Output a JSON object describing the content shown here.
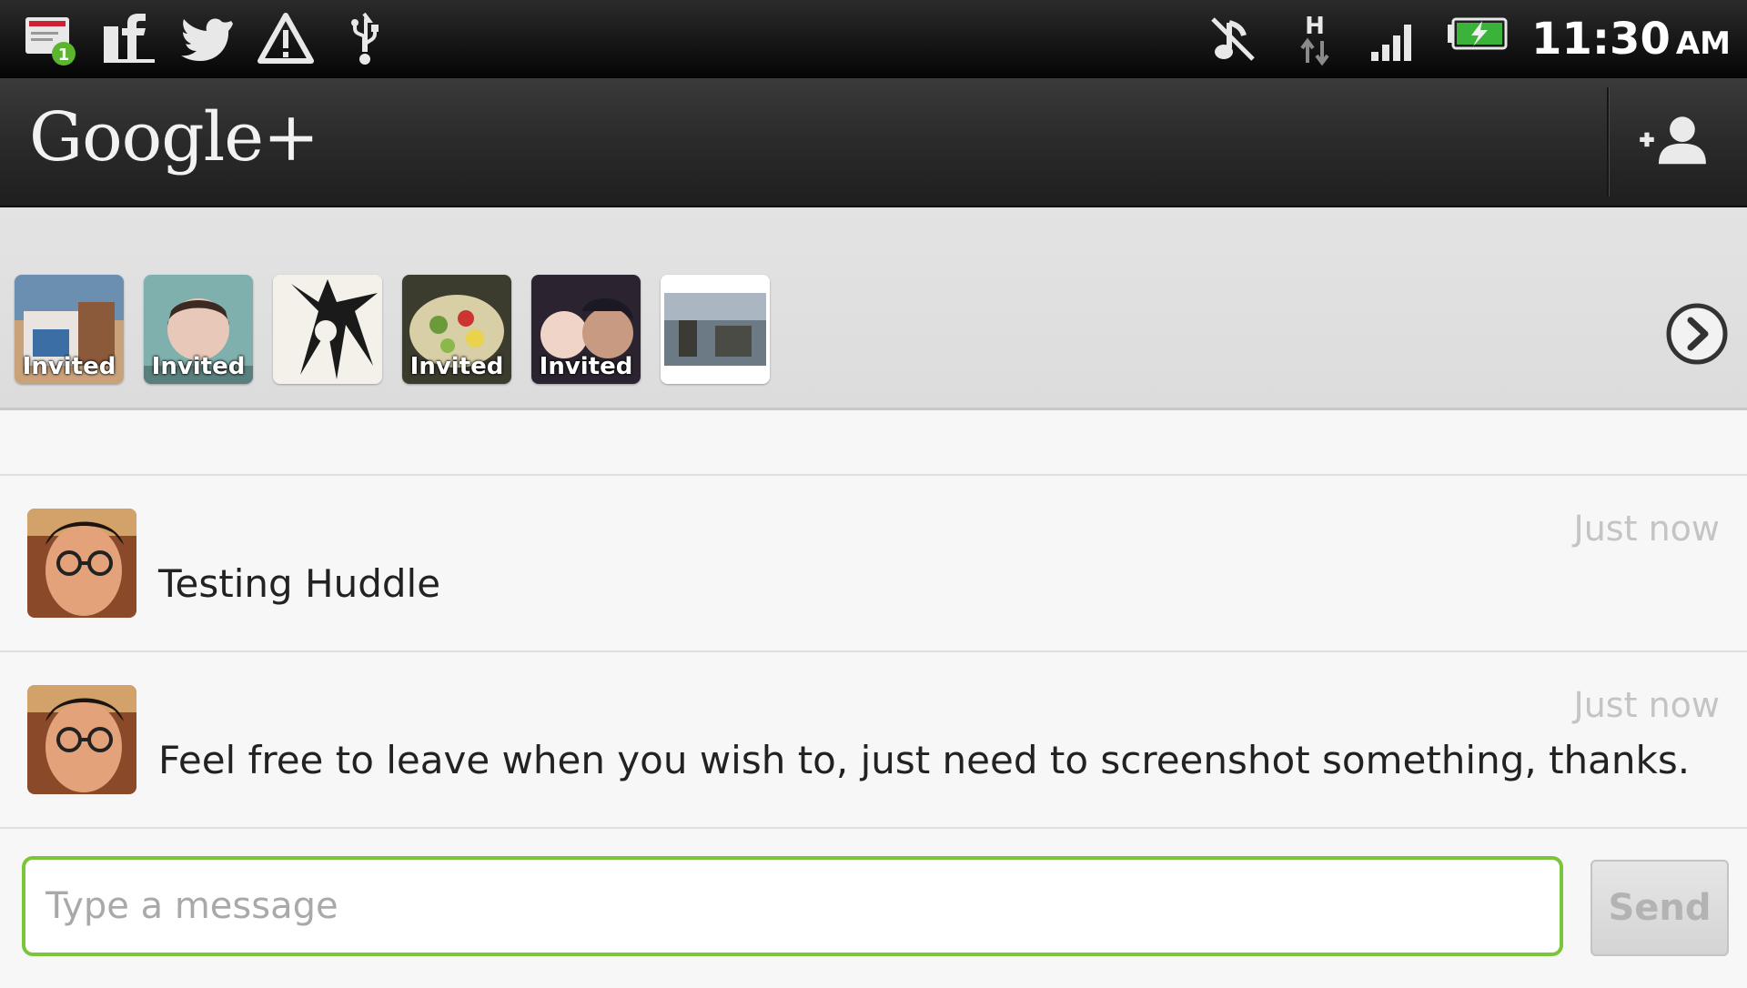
{
  "status_bar": {
    "left_icons": [
      "notification-icon",
      "facebook-icon",
      "twitter-icon",
      "warning-icon",
      "usb-icon"
    ],
    "notification_badge": "1",
    "right_icons": [
      "music-muted-icon",
      "data-h-icon",
      "signal-icon",
      "battery-icon"
    ],
    "network_label": "H",
    "time": "11:30",
    "ampm": "AM"
  },
  "app_bar": {
    "title": "Google+",
    "action_icon": "add-person-icon"
  },
  "participants": {
    "items": [
      {
        "label": "Invited"
      },
      {
        "label": "Invited"
      },
      {
        "label": ""
      },
      {
        "label": "Invited"
      },
      {
        "label": "Invited"
      },
      {
        "label": ""
      }
    ],
    "next_icon": "chevron-right-circle-icon"
  },
  "messages": [
    {
      "time": "Just now",
      "text": "Testing Huddle"
    },
    {
      "time": "Just now",
      "text": "Feel free to leave when you wish to, just need to screenshot something, thanks."
    }
  ],
  "composer": {
    "placeholder": "Type a message",
    "value": "",
    "send_label": "Send"
  },
  "colors": {
    "accent_green": "#7ac53a",
    "app_bar": "#2a2a2a",
    "timestamp": "#c4c4c4"
  }
}
